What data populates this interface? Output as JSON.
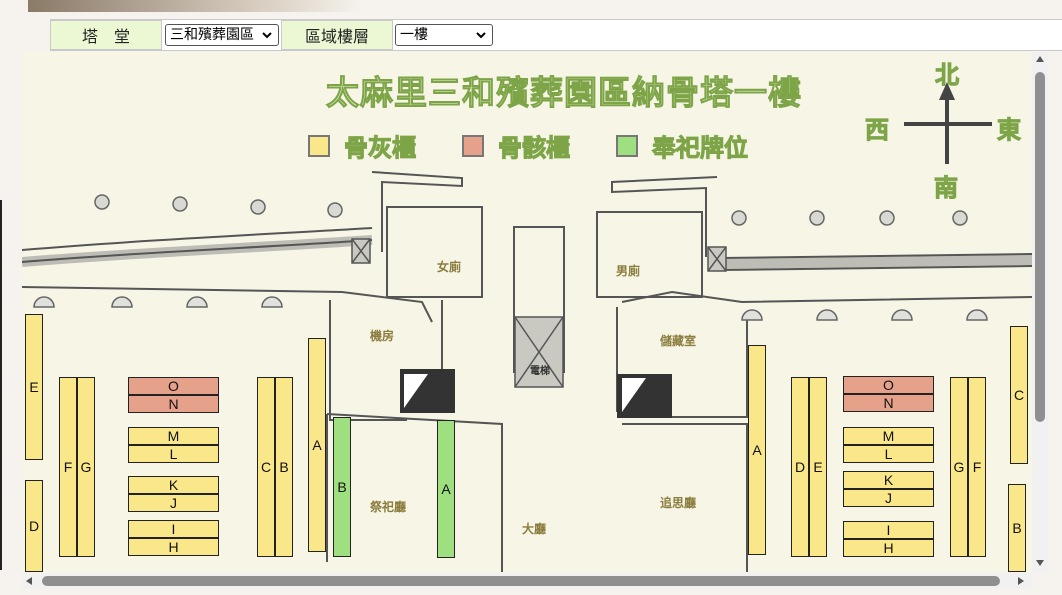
{
  "toolbar": {
    "tower_label": "塔　堂",
    "tower_value": "三和殯葬園區",
    "floor_label": "區域樓層",
    "floor_value": "一樓"
  },
  "map": {
    "title": "太麻里三和殯葬園區納骨塔一樓",
    "legend": [
      {
        "label": "骨灰櫃",
        "color": "#fae78a"
      },
      {
        "label": "骨骸櫃",
        "color": "#e5a18a"
      },
      {
        "label": "奉祀牌位",
        "color": "#9ee07f"
      }
    ],
    "compass": {
      "north": "北",
      "south": "南",
      "west": "西",
      "east": "東"
    },
    "rooms": {
      "women_restroom": "女廁",
      "men_restroom": "男廁",
      "machine_room": "機房",
      "storage_room": "儲藏室",
      "ceremony_room": "祭祀廳",
      "memorial_room": "追思廳",
      "lobby": "大廳",
      "elevator": "電梯"
    },
    "cabinets": {
      "left_E": "E",
      "left_D": "D",
      "left_F": "F",
      "left_G": "G",
      "left_O": "O",
      "left_N": "N",
      "left_M": "M",
      "left_L": "L",
      "left_K": "K",
      "left_J": "J",
      "left_I": "I",
      "left_H": "H",
      "left_C": "C",
      "left_B": "B",
      "left_A": "A",
      "plaque_B": "B",
      "plaque_A": "A",
      "right_A": "A",
      "right_D": "D",
      "right_E": "E",
      "right_O": "O",
      "right_N": "N",
      "right_M": "M",
      "right_L": "L",
      "right_K": "K",
      "right_J": "J",
      "right_I": "I",
      "right_H": "H",
      "right_G": "G",
      "right_F": "F",
      "right_C": "C",
      "right_B": "B"
    }
  }
}
